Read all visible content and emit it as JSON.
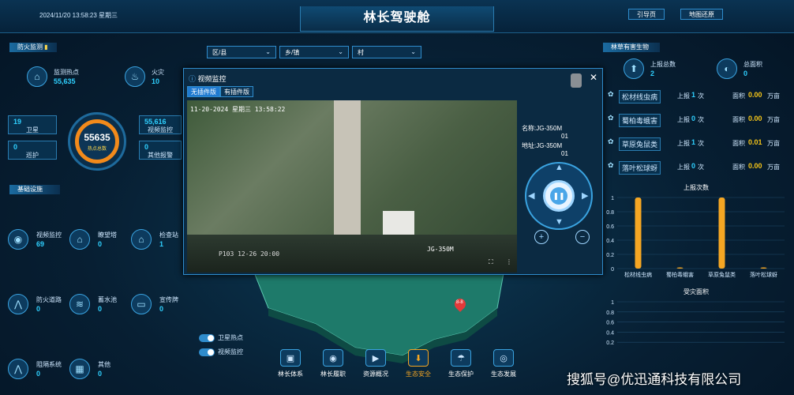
{
  "header": {
    "datetime": "2024/11/20 13:58:23 星期三",
    "title": "林长驾驶舱",
    "nav": [
      "引导页",
      "地图还原"
    ]
  },
  "left": {
    "fire_section": "防火监测",
    "hotspot_label": "监测热点",
    "hotspot_value": "55,635",
    "fire_label": "火灾",
    "fire_value": "10",
    "satellite_value": "19",
    "satellite_label": "卫星",
    "patrol_value": "0",
    "patrol_label": "巡护",
    "center_value": "55635",
    "center_label": "热点总数",
    "video_value": "55,616",
    "video_label": "视频监控",
    "other_value": "0",
    "other_label": "其他报警",
    "infra_section": "基础设施",
    "infra": [
      {
        "label": "视频监控",
        "value": "69",
        "icon": "camera-icon"
      },
      {
        "label": "瞭望塔",
        "value": "0",
        "icon": "tower-icon"
      },
      {
        "label": "检查站",
        "value": "1",
        "icon": "checkpoint-icon"
      },
      {
        "label": "防火道路",
        "value": "0",
        "icon": "road-icon"
      },
      {
        "label": "蓄水池",
        "value": "0",
        "icon": "reservoir-icon"
      },
      {
        "label": "宣传牌",
        "value": "0",
        "icon": "sign-icon"
      },
      {
        "label": "阻隔系统",
        "value": "0",
        "icon": "barrier-icon"
      },
      {
        "label": "其他",
        "value": "0",
        "icon": "grid-icon"
      }
    ]
  },
  "filters": [
    {
      "label": "区/县",
      "chevron": "chevron-down-icon"
    },
    {
      "label": "乡/镇",
      "chevron": "chevron-down-icon"
    },
    {
      "label": "村",
      "chevron": "chevron-down-icon"
    }
  ],
  "modal": {
    "title": "视频监控",
    "tabs": [
      "无插件版",
      "有插件版"
    ],
    "overlay_time": "11-20-2024 星期三 13:58:22",
    "overlay_bottom_left": "P103 12-26 20:00",
    "overlay_camera": "JG-350M",
    "name_label": "名称:JG-350M",
    "name_suffix": "01",
    "addr_label": "地址:JG-350M",
    "addr_suffix": "01"
  },
  "toggles": [
    "卫星热点",
    "视频监控"
  ],
  "map": {
    "marker": "8-8"
  },
  "bottom_nav": [
    {
      "label": "林长体系",
      "icon": "hierarchy-icon"
    },
    {
      "label": "林长履职",
      "icon": "duty-icon"
    },
    {
      "label": "资源概况",
      "icon": "resource-icon"
    },
    {
      "label": "生态安全",
      "icon": "security-icon",
      "active": true
    },
    {
      "label": "生态保护",
      "icon": "protection-icon"
    },
    {
      "label": "生态发展",
      "icon": "development-icon"
    }
  ],
  "right": {
    "section": "林草有害生物",
    "report_total_label": "上报总数",
    "report_total_value": "2",
    "area_total_label": "总面积",
    "area_total_value": "0",
    "pests": [
      {
        "name": "松材线虫病",
        "report_label": "上报",
        "report": "1",
        "unit": "次",
        "area_label": "面积",
        "area": "0.00",
        "area_unit": "万亩"
      },
      {
        "name": "蜀柏毒蛾害",
        "report_label": "上报",
        "report": "0",
        "unit": "次",
        "area_label": "面积",
        "area": "0.00",
        "area_unit": "万亩"
      },
      {
        "name": "草原兔鼠类",
        "report_label": "上报",
        "report": "1",
        "unit": "次",
        "area_label": "面积",
        "area": "0.01",
        "area_unit": "万亩"
      },
      {
        "name": "落叶松球蚜",
        "report_label": "上报",
        "report": "0",
        "unit": "次",
        "area_label": "面积",
        "area": "0.00",
        "area_unit": "万亩"
      }
    ],
    "chart1_title": "上报次数",
    "chart2_title": "受灾面积"
  },
  "chart_data": [
    {
      "type": "bar",
      "title": "上报次数",
      "categories": [
        "松材线虫病",
        "蜀柏毒蛾害",
        "草原兔鼠类",
        "落叶松球蚜"
      ],
      "values": [
        1,
        0,
        1,
        0
      ],
      "ylim": [
        0,
        1
      ],
      "yticks": [
        "1",
        "0.8",
        "0.6",
        "0.4",
        "0.2",
        "0"
      ]
    },
    {
      "type": "bar",
      "title": "受灾面积",
      "categories": [],
      "values": [],
      "ylim": [
        0,
        1
      ],
      "yticks": [
        "1",
        "0.8",
        "0.6",
        "0.4",
        "0.2"
      ]
    }
  ],
  "watermark": "搜狐号@优迅通科技有限公司",
  "colors": {
    "accent": "#2fd0ff",
    "bar": "#f5a623",
    "area_value": "#f5c518"
  }
}
